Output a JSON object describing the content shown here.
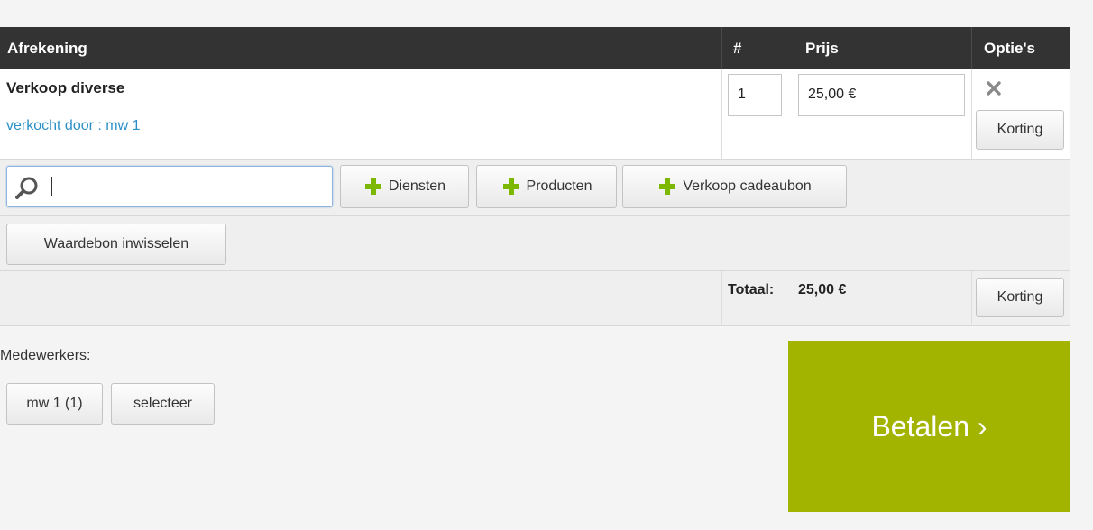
{
  "header": {
    "col_afrekening": "Afrekening",
    "col_count": "#",
    "col_price": "Prijs",
    "col_options": "Optie's"
  },
  "item": {
    "name": "Verkoop diverse",
    "seller": "verkocht door : mw 1",
    "quantity": "1",
    "price": "25,00 €",
    "discount_label": "Korting"
  },
  "toolbar": {
    "search_value": "",
    "services_label": "Diensten",
    "products_label": "Producten",
    "gift_voucher_label": "Verkoop cadeaubon",
    "redeem_voucher_label": "Waardebon inwisselen"
  },
  "totals": {
    "label": "Totaal:",
    "value": "25,00 €",
    "discount_label": "Korting"
  },
  "staff": {
    "label": "Medewerkers:",
    "current": "mw 1 (1)",
    "select_label": "selecteer"
  },
  "pay_button": "Betalen ›",
  "colors": {
    "header_bg": "#333333",
    "link": "#2b8fc6",
    "pay_bg": "#a2b400",
    "plus_icon": "#7cb800"
  },
  "icons": [
    "search-icon",
    "plus-icon",
    "close-icon"
  ]
}
